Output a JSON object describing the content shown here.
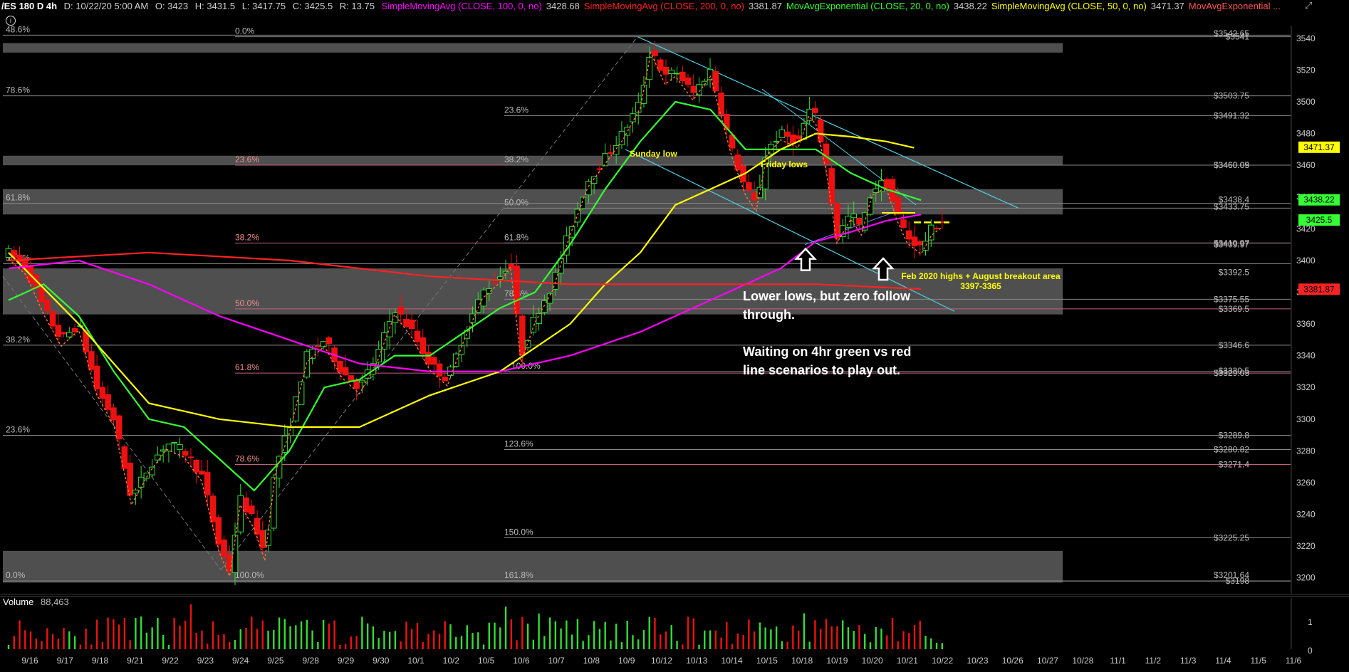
{
  "header": {
    "symbol": "/ES 180 D 4h",
    "date": "D: 10/22/20 5:00 AM",
    "open": "O: 3423",
    "high": "H: 3431.5",
    "low": "L: 3417.75",
    "close": "C: 3425.5",
    "range": "R: 13.75",
    "studies": [
      {
        "label": "SimpleMovingAvg (CLOSE, 100, 0, no)",
        "value": "3428.68",
        "color": "#ff00ff"
      },
      {
        "label": "SimpleMovingAvg (CLOSE, 200, 0, no)",
        "value": "3381.87",
        "color": "#ff2222"
      },
      {
        "label": "MovAvgExponential (CLOSE, 20, 0, no)",
        "value": "3438.22",
        "color": "#33ff33"
      },
      {
        "label": "SimpleMovingAvg (CLOSE, 50, 0, no)",
        "value": "3471.37",
        "color": "#ffff00"
      },
      {
        "label": "MovAvgExponential ...",
        "value": "",
        "color": "#ff5555"
      }
    ]
  },
  "icons": {
    "corner": "collapse-icon",
    "circle": "info-icon"
  },
  "chart_data": {
    "type": "candlestick",
    "ylim": [
      3190,
      3548
    ],
    "y_ticks": [
      3200,
      3220,
      3240,
      3260,
      3280,
      3300,
      3320,
      3340,
      3360,
      3380,
      3400,
      3420,
      3440,
      3460,
      3480,
      3500,
      3520,
      3540
    ],
    "x_ticks": [
      "9/16",
      "9/17",
      "9/18",
      "9/21",
      "9/22",
      "9/23",
      "9/24",
      "9/25",
      "9/28",
      "9/29",
      "9/30",
      "10/1",
      "10/2",
      "10/5",
      "10/6",
      "10/7",
      "10/8",
      "10/9",
      "10/12",
      "10/13",
      "10/14",
      "10/15",
      "10/18",
      "10/19",
      "10/20",
      "10/21",
      "10/22",
      "10/23",
      "10/26",
      "10/27",
      "10/28",
      "11/1",
      "11/2",
      "11/3",
      "11/4",
      "11/5",
      "11/6"
    ],
    "last_bar_index": 26,
    "price_path": [
      [
        0,
        3405
      ],
      [
        0.5,
        3395
      ],
      [
        1,
        3370
      ],
      [
        1.5,
        3350
      ],
      [
        2,
        3360
      ],
      [
        2.5,
        3320
      ],
      [
        3,
        3300
      ],
      [
        3.5,
        3250
      ],
      [
        4,
        3270
      ],
      [
        4.5,
        3285
      ],
      [
        5,
        3280
      ],
      [
        5.5,
        3265
      ],
      [
        6,
        3220
      ],
      [
        6.3,
        3205
      ],
      [
        6.6,
        3250
      ],
      [
        7,
        3235
      ],
      [
        7.3,
        3215
      ],
      [
        7.6,
        3270
      ],
      [
        8,
        3295
      ],
      [
        8.5,
        3340
      ],
      [
        9,
        3350
      ],
      [
        9.5,
        3330
      ],
      [
        10,
        3320
      ],
      [
        10.5,
        3340
      ],
      [
        11,
        3370
      ],
      [
        11.5,
        3355
      ],
      [
        12,
        3335
      ],
      [
        12.5,
        3325
      ],
      [
        13,
        3355
      ],
      [
        13.5,
        3380
      ],
      [
        14,
        3390
      ],
      [
        14.3,
        3400
      ],
      [
        14.6,
        3340
      ],
      [
        15,
        3365
      ],
      [
        15.5,
        3385
      ],
      [
        16,
        3420
      ],
      [
        16.5,
        3450
      ],
      [
        17,
        3465
      ],
      [
        17.5,
        3480
      ],
      [
        18,
        3500
      ],
      [
        18.3,
        3535
      ],
      [
        18.7,
        3515
      ],
      [
        19,
        3520
      ],
      [
        19.5,
        3505
      ],
      [
        20,
        3520
      ],
      [
        20.3,
        3495
      ],
      [
        20.6,
        3470
      ],
      [
        21,
        3445
      ],
      [
        21.3,
        3435
      ],
      [
        21.6,
        3470
      ],
      [
        22,
        3480
      ],
      [
        22.5,
        3475
      ],
      [
        22.8,
        3495
      ],
      [
        23,
        3490
      ],
      [
        23.3,
        3460
      ],
      [
        23.6,
        3415
      ],
      [
        24,
        3430
      ],
      [
        24.3,
        3420
      ],
      [
        24.6,
        3445
      ],
      [
        25,
        3450
      ],
      [
        25.3,
        3430
      ],
      [
        25.6,
        3415
      ],
      [
        26,
        3408
      ],
      [
        26.3,
        3420
      ],
      [
        26.6,
        3425
      ]
    ],
    "moving_averages": [
      {
        "name": "EMA 20",
        "color": "#33ff33",
        "points": [
          [
            0,
            3375
          ],
          [
            1,
            3385
          ],
          [
            2,
            3365
          ],
          [
            3,
            3330
          ],
          [
            4,
            3300
          ],
          [
            5,
            3295
          ],
          [
            6,
            3275
          ],
          [
            7,
            3255
          ],
          [
            8,
            3280
          ],
          [
            9,
            3320
          ],
          [
            10,
            3325
          ],
          [
            11,
            3340
          ],
          [
            12,
            3340
          ],
          [
            13,
            3355
          ],
          [
            14,
            3370
          ],
          [
            15,
            3380
          ],
          [
            16,
            3410
          ],
          [
            17,
            3445
          ],
          [
            18,
            3475
          ],
          [
            19,
            3500
          ],
          [
            20,
            3495
          ],
          [
            21,
            3470
          ],
          [
            22,
            3470
          ],
          [
            23,
            3470
          ],
          [
            24,
            3455
          ],
          [
            25,
            3445
          ],
          [
            26,
            3438
          ]
        ]
      },
      {
        "name": "SMA 50",
        "color": "#ffff00",
        "points": [
          [
            0,
            3405
          ],
          [
            2,
            3360
          ],
          [
            4,
            3310
          ],
          [
            6,
            3300
          ],
          [
            8,
            3295
          ],
          [
            10,
            3295
          ],
          [
            12,
            3315
          ],
          [
            14,
            3330
          ],
          [
            16,
            3360
          ],
          [
            17,
            3385
          ],
          [
            18,
            3405
          ],
          [
            19,
            3435
          ],
          [
            20,
            3445
          ],
          [
            21,
            3455
          ],
          [
            22,
            3470
          ],
          [
            23,
            3480
          ],
          [
            24,
            3478
          ],
          [
            25,
            3475
          ],
          [
            25.8,
            3471
          ]
        ]
      },
      {
        "name": "SMA 100",
        "color": "#ff00ff",
        "points": [
          [
            0,
            3395
          ],
          [
            2,
            3400
          ],
          [
            4,
            3385
          ],
          [
            6,
            3365
          ],
          [
            8,
            3350
          ],
          [
            10,
            3335
          ],
          [
            12,
            3330
          ],
          [
            14,
            3330
          ],
          [
            16,
            3340
          ],
          [
            18,
            3355
          ],
          [
            20,
            3375
          ],
          [
            22,
            3395
          ],
          [
            23,
            3412
          ],
          [
            24,
            3418
          ],
          [
            25,
            3425
          ],
          [
            26,
            3429
          ]
        ]
      },
      {
        "name": "SMA 200",
        "color": "#ff2222",
        "points": [
          [
            0,
            3400
          ],
          [
            4,
            3405
          ],
          [
            8,
            3400
          ],
          [
            12,
            3390
          ],
          [
            16,
            3385
          ],
          [
            20,
            3385
          ],
          [
            23,
            3385
          ],
          [
            26,
            3382
          ]
        ]
      }
    ],
    "zones": [
      {
        "y1": 3531,
        "y2": 3537
      },
      {
        "y1": 3429,
        "y2": 3445
      },
      {
        "y1": 3366,
        "y2": 3395
      },
      {
        "y1": 3197,
        "y2": 3217
      },
      {
        "y1": 3460,
        "y2": 3466
      }
    ],
    "fib_lines": [
      {
        "y": 3541,
        "label": "0.0%"
      },
      {
        "y": 3503.75,
        "label": "78.6%"
      },
      {
        "y": 3491.32,
        "label": "23.6%"
      },
      {
        "y": 3460.09,
        "label": "23.6%"
      },
      {
        "y": 3460.09,
        "label": "38.2%"
      },
      {
        "y": 3433,
        "label": "50.0%"
      },
      {
        "y": 3411,
        "label": "38.2%"
      },
      {
        "y": 3411,
        "label": "61.8%"
      },
      {
        "y": 3369.5,
        "label": "50.0%"
      },
      {
        "y": 3375.55,
        "label": "78.6%"
      },
      {
        "y": 3346.6,
        "label": "38.2%"
      },
      {
        "y": 3330,
        "label": "100.0%"
      },
      {
        "y": 3329.03,
        "label": "61.8%"
      },
      {
        "y": 3289.8,
        "label": "23.6%"
      },
      {
        "y": 3280.82,
        "label": "123.6%"
      },
      {
        "y": 3271.4,
        "label": "78.6%"
      },
      {
        "y": 3225.25,
        "label": "150.0%"
      },
      {
        "y": 3198,
        "label": "161.8%"
      },
      {
        "y": 3198,
        "label": "0.0%"
      },
      {
        "y": 3198,
        "label": "100.0%"
      },
      {
        "y": 3436,
        "label": "61.8%"
      },
      {
        "y": 3398,
        "label": "50.0%"
      },
      {
        "y": 3542,
        "label": "48.6%"
      }
    ],
    "right_labels": [
      {
        "y": 3543,
        "text": "$3542.65"
      },
      {
        "y": 3541,
        "text": "$3541"
      },
      {
        "y": 3503.75,
        "text": "$3503.75"
      },
      {
        "y": 3491.32,
        "text": "$3491.32"
      },
      {
        "y": 3460.09,
        "text": "$3460.09"
      },
      {
        "y": 3460,
        "text": "$3460.05"
      },
      {
        "y": 3438.4,
        "text": "$3438.4"
      },
      {
        "y": 3433.75,
        "text": "$3433.75"
      },
      {
        "y": 3410.97,
        "text": "$3410.97"
      },
      {
        "y": 3409.97,
        "text": "$3409.97"
      },
      {
        "y": 3392.5,
        "text": "$3392.5"
      },
      {
        "y": 3375.55,
        "text": "$3375.55"
      },
      {
        "y": 3369.5,
        "text": "$3369.5"
      },
      {
        "y": 3346.6,
        "text": "$3346.6"
      },
      {
        "y": 3330.5,
        "text": "$3330.5"
      },
      {
        "y": 3329.03,
        "text": "$3329.03"
      },
      {
        "y": 3289.8,
        "text": "$3289.8"
      },
      {
        "y": 3280.82,
        "text": "$3280.82"
      },
      {
        "y": 3271.4,
        "text": "$3271.4"
      },
      {
        "y": 3225.25,
        "text": "$3225.25"
      },
      {
        "y": 3201.64,
        "text": "$3201.64"
      },
      {
        "y": 3198,
        "text": "$3198"
      }
    ],
    "price_tags": [
      {
        "y": 3471.37,
        "text": "3471.37",
        "bg": "#ffff00",
        "fg": "#000"
      },
      {
        "y": 3438.22,
        "text": "3438.22",
        "bg": "#33ff33",
        "fg": "#000"
      },
      {
        "y": 3425.5,
        "text": "3425.5",
        "bg": "#33ff33",
        "fg": "#000"
      },
      {
        "y": 3381.87,
        "text": "3381.87",
        "bg": "#ff2222",
        "fg": "#000"
      }
    ],
    "volume_ticks": [
      "1",
      "0"
    ]
  },
  "volume": {
    "label": "Volume",
    "value": "88,463"
  },
  "annotations": {
    "main1": "Lower lows, but zero follow\nthrough.",
    "main2": "Waiting on 4hr green vs red\nline scenarios to play out.",
    "feb": "Feb 2020 highs + August breakout area\n3397-3365",
    "sunday": "Sunday low",
    "friday": "Friday lows"
  }
}
